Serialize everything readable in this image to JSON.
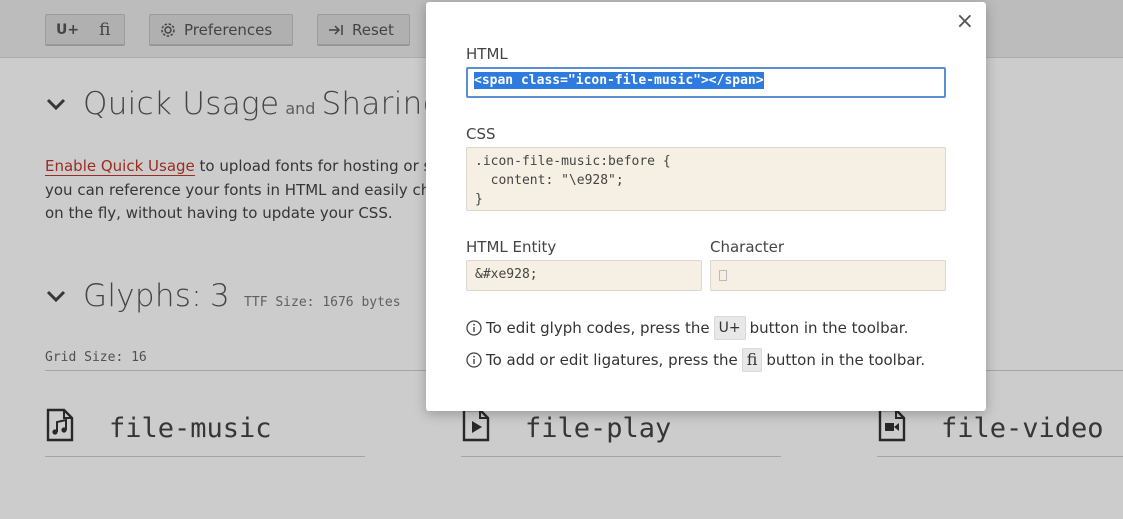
{
  "toolbar": {
    "unicode_button": "U+",
    "ligature_button": "ﬁ",
    "preferences_label": "Preferences",
    "reset_label": "Reset"
  },
  "quick_usage": {
    "title_part1": "Quick Usage",
    "title_and": "and",
    "title_part2": "Sharing",
    "enable_link": "Enable Quick Usage",
    "text_line1": " to upload fonts for hosting or sh",
    "text_line2": "you can reference your fonts in HTML and easily char",
    "text_line3": "on the fly, without having to update your CSS."
  },
  "glyphs_section": {
    "title": "Glyphs:",
    "count": "3",
    "ttf_size": "TTF Size: 1676 bytes",
    "grid_size": "Grid Size: 16",
    "items": [
      {
        "name": "file-music",
        "icon": "file-music-icon"
      },
      {
        "name": "file-play",
        "icon": "file-play-icon"
      },
      {
        "name": "file-video",
        "icon": "file-video-icon"
      }
    ]
  },
  "modal": {
    "html_label": "HTML",
    "html_value": "<span class=\"icon-file-music\"></span>",
    "css_label": "CSS",
    "css_value": ".icon-file-music:before {\n  content: \"\\e928\";\n}",
    "entity_label": "HTML Entity",
    "entity_value": "&#xe928;",
    "character_label": "Character",
    "tip1_before": "To edit glyph codes, press the",
    "tip1_key": "U+",
    "tip1_after": "button in the toolbar.",
    "tip2_before": "To add or edit ligatures, press the",
    "tip2_key": "ﬁ",
    "tip2_after": "button in the toolbar.",
    "close_symbol": "×"
  },
  "colors": {
    "link": "#c0392b",
    "selection": "#2e7be0",
    "field_bg": "#f6efe4"
  }
}
